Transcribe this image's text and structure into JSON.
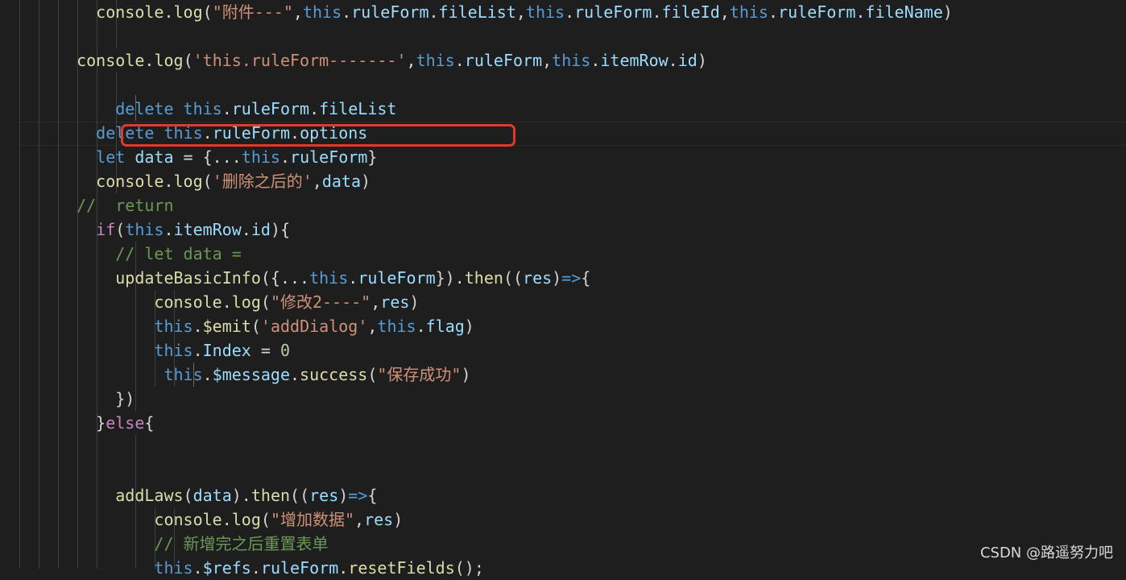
{
  "colors": {
    "background": "#1e1e1e",
    "keyword": "#569cd6",
    "control": "#c586c0",
    "function": "#dcdcaa",
    "property": "#9cdcfe",
    "string": "#ce9178",
    "number": "#b5cea8",
    "comment": "#6a9955",
    "highlight_box": "#e03a2f"
  },
  "code": {
    "lines": [
      [
        [
          "pun",
          "    "
        ],
        [
          "fn",
          "console"
        ],
        [
          "pun",
          "."
        ],
        [
          "fn",
          "log"
        ],
        [
          "pun",
          "("
        ],
        [
          "str",
          "\"附件---\""
        ],
        [
          "pun",
          ","
        ],
        [
          "kw",
          "this"
        ],
        [
          "pun",
          "."
        ],
        [
          "prop",
          "ruleForm"
        ],
        [
          "pun",
          "."
        ],
        [
          "prop",
          "fileList"
        ],
        [
          "pun",
          ","
        ],
        [
          "kw",
          "this"
        ],
        [
          "pun",
          "."
        ],
        [
          "prop",
          "ruleForm"
        ],
        [
          "pun",
          "."
        ],
        [
          "prop",
          "fileId"
        ],
        [
          "pun",
          ","
        ],
        [
          "kw",
          "this"
        ],
        [
          "pun",
          "."
        ],
        [
          "prop",
          "ruleForm"
        ],
        [
          "pun",
          "."
        ],
        [
          "prop",
          "fileName"
        ],
        [
          "pun",
          ")"
        ]
      ],
      [],
      [
        [
          "pun",
          "  "
        ],
        [
          "fn",
          "console"
        ],
        [
          "pun",
          "."
        ],
        [
          "fn",
          "log"
        ],
        [
          "pun",
          "("
        ],
        [
          "str",
          "'this.ruleForm-------'"
        ],
        [
          "pun",
          ","
        ],
        [
          "kw",
          "this"
        ],
        [
          "pun",
          "."
        ],
        [
          "prop",
          "ruleForm"
        ],
        [
          "pun",
          ","
        ],
        [
          "kw",
          "this"
        ],
        [
          "pun",
          "."
        ],
        [
          "prop",
          "itemRow"
        ],
        [
          "pun",
          "."
        ],
        [
          "prop",
          "id"
        ],
        [
          "pun",
          ")"
        ]
      ],
      [],
      [
        [
          "pun",
          "      "
        ],
        [
          "kw",
          "delete"
        ],
        [
          "pun",
          " "
        ],
        [
          "kw",
          "this"
        ],
        [
          "pun",
          "."
        ],
        [
          "prop",
          "ruleForm"
        ],
        [
          "pun",
          "."
        ],
        [
          "prop",
          "fileList"
        ]
      ],
      [
        [
          "pun",
          "    "
        ],
        [
          "kw",
          "delete"
        ],
        [
          "pun",
          " "
        ],
        [
          "kw",
          "this"
        ],
        [
          "pun",
          "."
        ],
        [
          "prop",
          "ruleForm"
        ],
        [
          "pun",
          "."
        ],
        [
          "prop",
          "options"
        ]
      ],
      [
        [
          "pun",
          "    "
        ],
        [
          "kw",
          "let"
        ],
        [
          "pun",
          " "
        ],
        [
          "prop",
          "data"
        ],
        [
          "pun",
          " = {..."
        ],
        [
          "kw",
          "this"
        ],
        [
          "pun",
          "."
        ],
        [
          "prop",
          "ruleForm"
        ],
        [
          "pun",
          "}"
        ]
      ],
      [
        [
          "pun",
          "    "
        ],
        [
          "fn",
          "console"
        ],
        [
          "pun",
          "."
        ],
        [
          "fn",
          "log"
        ],
        [
          "pun",
          "("
        ],
        [
          "str",
          "'删除之后的'"
        ],
        [
          "pun",
          ","
        ],
        [
          "prop",
          "data"
        ],
        [
          "pun",
          ")"
        ]
      ],
      [
        [
          "cm",
          "  //  return"
        ]
      ],
      [
        [
          "pun",
          "    "
        ],
        [
          "ctl",
          "if"
        ],
        [
          "pun",
          "("
        ],
        [
          "kw",
          "this"
        ],
        [
          "pun",
          "."
        ],
        [
          "prop",
          "itemRow"
        ],
        [
          "pun",
          "."
        ],
        [
          "prop",
          "id"
        ],
        [
          "pun",
          "){"
        ]
      ],
      [
        [
          "cm",
          "      // let data ="
        ]
      ],
      [
        [
          "pun",
          "      "
        ],
        [
          "fn",
          "updateBasicInfo"
        ],
        [
          "pun",
          "({..."
        ],
        [
          "kw",
          "this"
        ],
        [
          "pun",
          "."
        ],
        [
          "prop",
          "ruleForm"
        ],
        [
          "pun",
          "})."
        ],
        [
          "fn",
          "then"
        ],
        [
          "pun",
          "(("
        ],
        [
          "prop",
          "res"
        ],
        [
          "pun",
          ")"
        ],
        [
          "kw",
          "=>"
        ],
        [
          "pun",
          "{"
        ]
      ],
      [
        [
          "pun",
          "          "
        ],
        [
          "fn",
          "console"
        ],
        [
          "pun",
          "."
        ],
        [
          "fn",
          "log"
        ],
        [
          "pun",
          "("
        ],
        [
          "str",
          "\"修改2----\""
        ],
        [
          "pun",
          ","
        ],
        [
          "prop",
          "res"
        ],
        [
          "pun",
          ")"
        ]
      ],
      [
        [
          "pun",
          "          "
        ],
        [
          "kw",
          "this"
        ],
        [
          "pun",
          "."
        ],
        [
          "fn",
          "$emit"
        ],
        [
          "pun",
          "("
        ],
        [
          "str",
          "'addDialog'"
        ],
        [
          "pun",
          ","
        ],
        [
          "kw",
          "this"
        ],
        [
          "pun",
          "."
        ],
        [
          "prop",
          "flag"
        ],
        [
          "pun",
          ")"
        ]
      ],
      [
        [
          "pun",
          "          "
        ],
        [
          "kw",
          "this"
        ],
        [
          "pun",
          "."
        ],
        [
          "prop",
          "Index"
        ],
        [
          "pun",
          " = "
        ],
        [
          "num",
          "0"
        ]
      ],
      [
        [
          "pun",
          "           "
        ],
        [
          "kw",
          "this"
        ],
        [
          "pun",
          "."
        ],
        [
          "prop",
          "$message"
        ],
        [
          "pun",
          "."
        ],
        [
          "fn",
          "success"
        ],
        [
          "pun",
          "("
        ],
        [
          "str",
          "\"保存成功\""
        ],
        [
          "pun",
          ")"
        ]
      ],
      [
        [
          "pun",
          "      })"
        ]
      ],
      [
        [
          "pun",
          "    }"
        ],
        [
          "ctl",
          "else"
        ],
        [
          "pun",
          "{"
        ]
      ],
      [],
      [],
      [
        [
          "pun",
          "      "
        ],
        [
          "fn",
          "addLaws"
        ],
        [
          "pun",
          "("
        ],
        [
          "prop",
          "data"
        ],
        [
          "pun",
          ")."
        ],
        [
          "fn",
          "then"
        ],
        [
          "pun",
          "(("
        ],
        [
          "prop",
          "res"
        ],
        [
          "pun",
          ")"
        ],
        [
          "kw",
          "=>"
        ],
        [
          "pun",
          "{"
        ]
      ],
      [
        [
          "pun",
          "          "
        ],
        [
          "fn",
          "console"
        ],
        [
          "pun",
          "."
        ],
        [
          "fn",
          "log"
        ],
        [
          "pun",
          "("
        ],
        [
          "str",
          "\"增加数据\""
        ],
        [
          "pun",
          ","
        ],
        [
          "prop",
          "res"
        ],
        [
          "pun",
          ")"
        ]
      ],
      [
        [
          "cm",
          "          // 新增完之后重置表单"
        ]
      ],
      [
        [
          "pun",
          "          "
        ],
        [
          "kw",
          "this"
        ],
        [
          "pun",
          "."
        ],
        [
          "prop",
          "$refs"
        ],
        [
          "pun",
          "."
        ],
        [
          "prop",
          "ruleForm"
        ],
        [
          "pun",
          "."
        ],
        [
          "fn",
          "resetFields"
        ],
        [
          "pun",
          "();"
        ]
      ]
    ]
  },
  "watermark": "CSDN @路遥努力吧"
}
